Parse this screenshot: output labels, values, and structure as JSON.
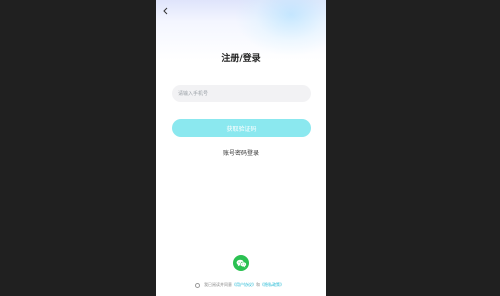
{
  "page": {
    "title": "注册/登录"
  },
  "icons": {
    "back": "chevron-left-icon",
    "wechat": "wechat-icon"
  },
  "form": {
    "phone_placeholder": "请输入手机号",
    "get_code_label": "获取验证码",
    "password_login_label": "账号密码登录"
  },
  "agreement": {
    "prefix": "我已阅读并同意",
    "user_agreement": "《用户协议》",
    "conjunction": "和",
    "privacy_policy": "《隐私政策》"
  },
  "colors": {
    "accent": "#8be8ef",
    "link": "#1fb8d4",
    "wechat": "#2bc152",
    "backdrop": "#202020"
  }
}
